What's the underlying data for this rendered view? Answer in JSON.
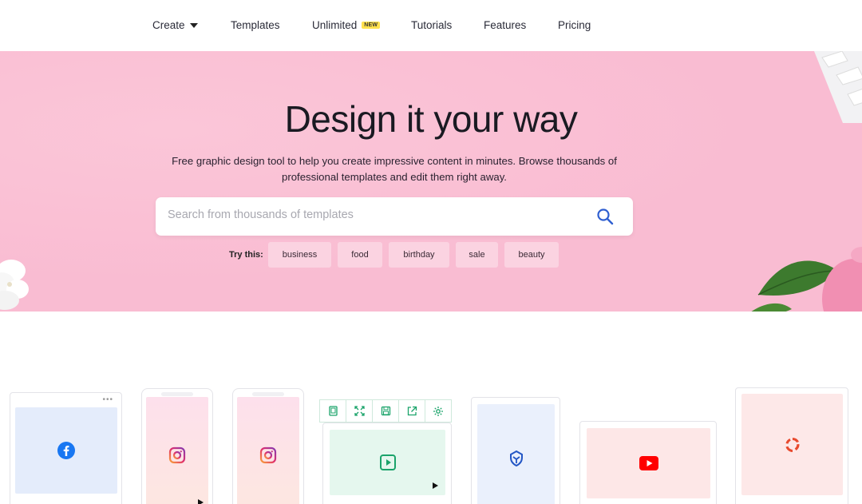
{
  "nav": {
    "items": [
      {
        "label": "Create",
        "has_caret": true
      },
      {
        "label": "Templates"
      },
      {
        "label": "Unlimited",
        "badge": "NEW"
      },
      {
        "label": "Tutorials"
      },
      {
        "label": "Features"
      },
      {
        "label": "Pricing"
      }
    ]
  },
  "hero": {
    "title": "Design it your way",
    "subtitle": "Free graphic design tool to help you create impressive content in minutes. Browse thousands of professional templates and edit them right away.",
    "search_placeholder": "Search from thousands of templates",
    "try_label": "Try this:",
    "chips": [
      "business",
      "food",
      "birthday",
      "sale",
      "beauty"
    ],
    "background_color": "#f9bcd2"
  },
  "devices": {
    "cards": [
      {
        "platform": "facebook",
        "icon": "facebook-icon",
        "screen_color": "#e4ecfb",
        "icon_color": "#1877f2"
      },
      {
        "platform": "instagram-story",
        "icon": "instagram-icon",
        "screen_color": "#fde3ea"
      },
      {
        "platform": "instagram-story",
        "icon": "instagram-icon",
        "screen_color": "#fde3ea"
      },
      {
        "platform": "video",
        "icon": "video-play-icon",
        "screen_color": "#e5f7ee",
        "icon_color": "#1aa36a"
      },
      {
        "platform": "poster",
        "icon": "badge-icon",
        "screen_color": "#eaf0fc",
        "icon_color": "#2356c5"
      },
      {
        "platform": "youtube",
        "icon": "youtube-icon",
        "screen_color": "#fde7e7",
        "icon_color": "#ff0000"
      },
      {
        "platform": "logo",
        "icon": "logo-icon",
        "screen_color": "#fde8e8",
        "icon_color": "#e84a2e"
      }
    ],
    "toolbar_icons": [
      "device-icon",
      "fullscreen-icon",
      "save-icon",
      "share-icon",
      "settings-icon"
    ]
  }
}
